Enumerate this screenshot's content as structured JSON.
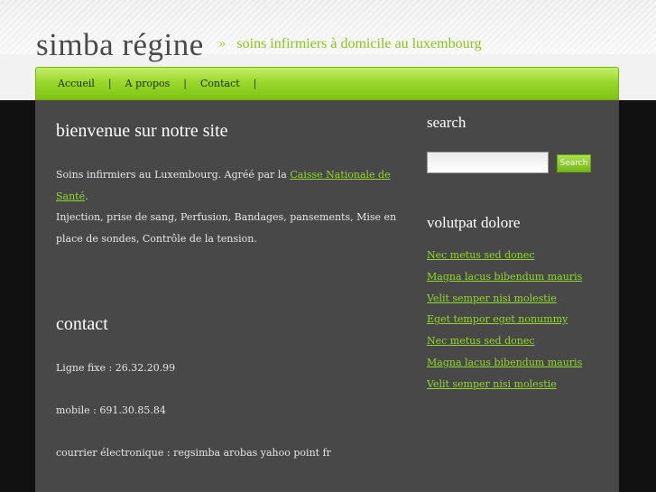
{
  "header": {
    "site_name": "simba régine",
    "separator": "»",
    "tagline": "soins infirmiers à domicile au luxembourg"
  },
  "nav": {
    "items": [
      "Accueil",
      "A propos",
      "Contact"
    ],
    "separator": "|"
  },
  "main": {
    "welcome_heading": "bienvenue sur notre site",
    "intro_prefix": "Soins infirmiers au Luxembourg. Agréé par la ",
    "intro_link": "Caisse Nationale de Santé",
    "intro_suffix": ".",
    "services": "Injection, prise de sang, Perfusion, Bandages, pansements, Mise en place de sondes, Contrôle de la tension.",
    "contact_heading": "contact",
    "phone": "Ligne fixe : 26.32.20.99",
    "mobile": "mobile : 691.30.85.84",
    "email": "courrier électronique : regsimba arobas yahoo point fr"
  },
  "sidebar": {
    "search_heading": "search",
    "search_value": "",
    "search_button": "Search",
    "links_heading": "volutpat dolore",
    "links": [
      "Nec metus sed donec",
      "Magna lacus bibendum mauris",
      "Velit semper nisi molestie",
      "Eget tempor eget nonummy",
      "Nec metus sed donec",
      "Magna lacus bibendum mauris",
      "Velit semper nisi molestie"
    ]
  },
  "colors": {
    "accent_green": "#8fd82a",
    "panel": "#484848",
    "nav_green": "#9ad82d"
  }
}
